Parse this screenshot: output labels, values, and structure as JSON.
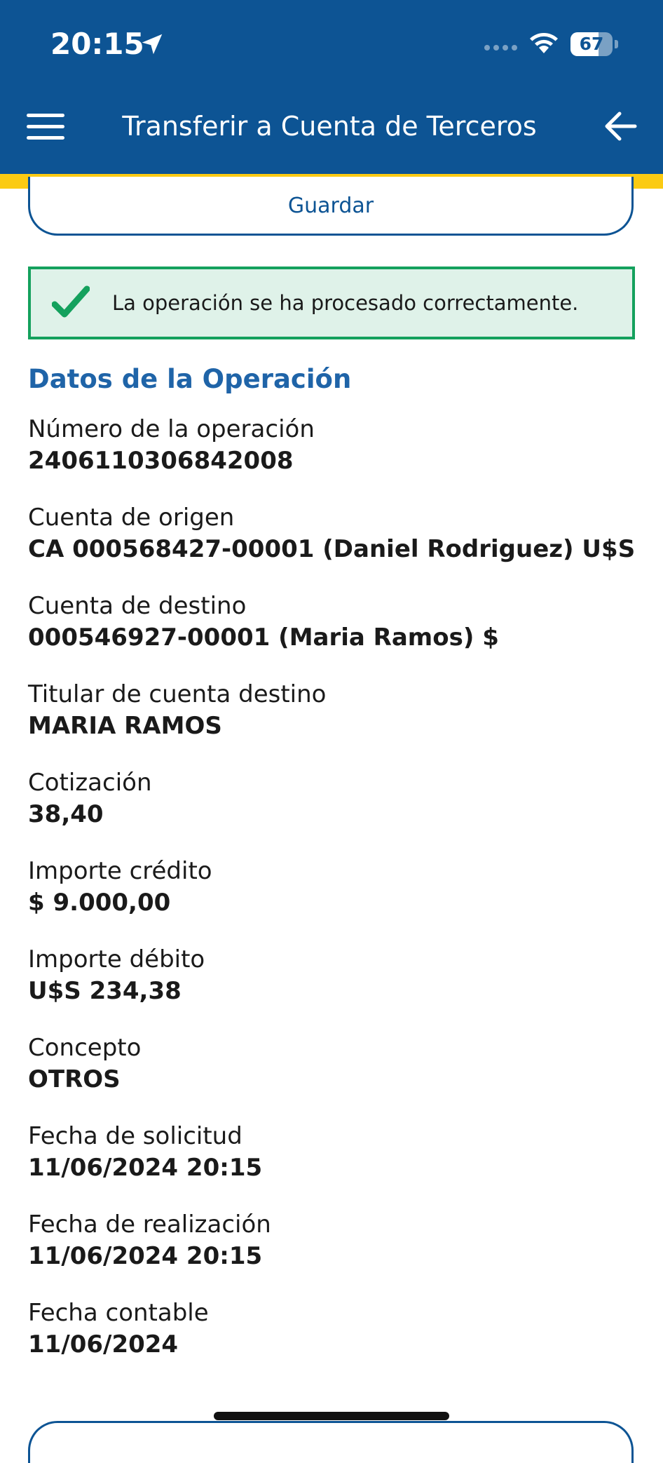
{
  "status_bar": {
    "time": "20:15",
    "battery_level": "67",
    "icons": [
      "location-arrow-icon",
      "cellular-signal-icon",
      "wifi-icon",
      "battery-icon"
    ]
  },
  "header": {
    "title": "Transferir a Cuenta de Terceros",
    "menu_icon": "hamburger-menu-icon",
    "back_icon": "back-arrow-icon",
    "background_color": "#0d5494",
    "accent_color": "#fbcb13"
  },
  "actions": {
    "save_label": "Guardar"
  },
  "alert": {
    "message": "La operación se ha procesado correctamente.",
    "icon": "checkmark-icon",
    "border_color": "#14a15d",
    "background_color": "#dff2e9"
  },
  "section": {
    "title": "Datos de la Operación",
    "color": "#1f64a8"
  },
  "fields": [
    {
      "label": "Número de la operación",
      "value": "2406110306842008"
    },
    {
      "label": "Cuenta de origen",
      "value": "CA 000568427-00001 (Daniel Rodriguez) U$S"
    },
    {
      "label": "Cuenta de destino",
      "value": "000546927-00001 (Maria Ramos) $"
    },
    {
      "label": "Titular de cuenta destino",
      "value": "MARIA RAMOS"
    },
    {
      "label": "Cotización",
      "value": "38,40"
    },
    {
      "label": "Importe crédito",
      "value": "$ 9.000,00"
    },
    {
      "label": "Importe débito",
      "value": "U$S 234,38"
    },
    {
      "label": "Concepto",
      "value": "OTROS"
    },
    {
      "label": "Fecha de solicitud",
      "value": "11/06/2024 20:15"
    },
    {
      "label": "Fecha de realización",
      "value": "11/06/2024 20:15"
    },
    {
      "label": "Fecha contable",
      "value": "11/06/2024"
    }
  ]
}
